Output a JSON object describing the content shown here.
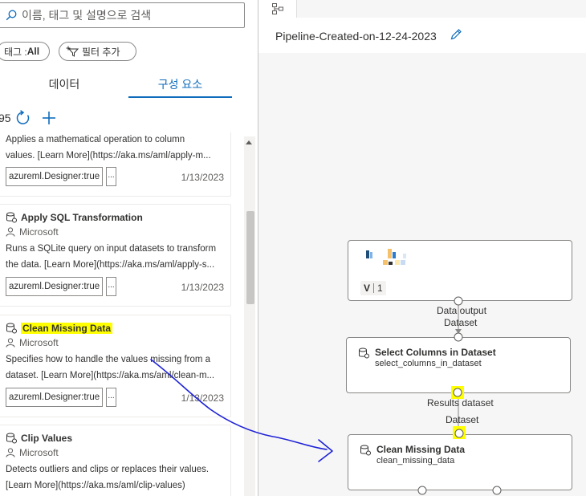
{
  "search": {
    "placeholder": "이름, 태그 및 설명으로 검색",
    "icon": "search-icon"
  },
  "filters": {
    "tag_label": "태그 : ",
    "tag_value": "All",
    "add_filter_label": "필터 추가"
  },
  "tabs": [
    {
      "label": "데이터",
      "active": false
    },
    {
      "label": "구성 요소",
      "active": true
    }
  ],
  "toolbar": {
    "count": "95"
  },
  "components": [
    {
      "title": "",
      "author": "",
      "description_lines": [
        "Applies a mathematical operation to column",
        "values. [Learn More](https://aka.ms/aml/apply-m..."
      ],
      "tag": "azureml.Designer:true",
      "more": "...",
      "date": "1/13/2023"
    },
    {
      "title": "Apply SQL Transformation",
      "author": "Microsoft",
      "description_lines": [
        "Runs a SQLite query on input datasets to transform",
        "the data. [Learn More](https://aka.ms/aml/apply-s..."
      ],
      "tag": "azureml.Designer:true",
      "more": "...",
      "date": "1/13/2023"
    },
    {
      "title": "Clean Missing Data",
      "highlighted": true,
      "author": "Microsoft",
      "description_lines": [
        "Specifies how to handle the values missing from a",
        "dataset. [Learn More](https://aka.ms/aml/clean-m..."
      ],
      "tag": "azureml.Designer:true",
      "more": "...",
      "date": "1/13/2023"
    },
    {
      "title": "Clip Values",
      "author": "Microsoft",
      "description_lines": [
        "Detects outliers and clips or replaces their values.",
        "[Learn More](https://aka.ms/aml/clip-values)"
      ],
      "tag": "",
      "more": "",
      "date": ""
    }
  ],
  "pipeline": {
    "title": "Pipeline-Created-on-12-24-2023"
  },
  "nodes": {
    "dataset": {
      "version_label": "V",
      "version": "1"
    },
    "select_columns": {
      "title": "Select Columns in Dataset",
      "subtitle": "select_columns_in_dataset"
    },
    "clean_missing": {
      "title": "Clean Missing Data",
      "subtitle": "clean_missing_data"
    }
  },
  "ports": {
    "data_output": "Data output",
    "dataset_in_1": "Dataset",
    "results_dataset": "Results dataset",
    "dataset_in_2": "Dataset"
  },
  "colors": {
    "accent": "#0f6cbd",
    "highlight": "#ffff00",
    "annotation_ink": "#1e22d6"
  }
}
